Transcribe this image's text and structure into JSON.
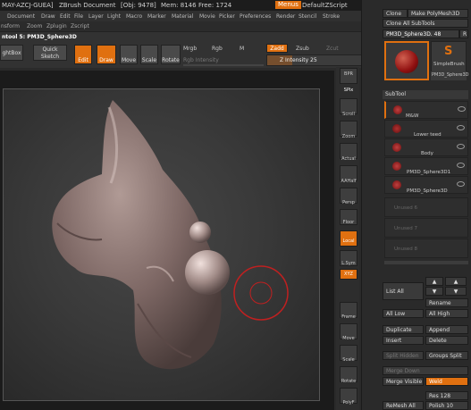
{
  "titlebar": {
    "doc_left": "MAY-AZCJ-GUEA]",
    "app": "ZBrush Document",
    "obj": "[Obj: 9478]",
    "mem": "Mem: 8146",
    "free": "Free: 1724",
    "menus": "Menus",
    "script": "DefaultZScript"
  },
  "menubar": [
    "Document",
    "Draw",
    "Edit",
    "File",
    "Layer",
    "Light",
    "Macro",
    "Marker",
    "Material",
    "Movie",
    "Picker",
    "Preferences",
    "Render",
    "Stencil",
    "Stroke"
  ],
  "subbar": [
    "nsform",
    "Zoom",
    "Zplugin",
    "Zscript"
  ],
  "tool_title": "ntool 5: PM3D_Sphere3D",
  "toolbar": {
    "lightbox": "ghtBox",
    "quick_sketch": "Quick Sketch",
    "edit": "Edit",
    "draw": "Draw",
    "move": "Move",
    "scale": "Scale",
    "rotate": "Rotate",
    "mrgb": "Mrgb",
    "rgb": "Rgb",
    "m": "M",
    "zadd": "Zadd",
    "zsub": "Zsub",
    "zcut": "Zcut",
    "rgb_intensity": "Rgb Intensity",
    "z_intensity": "Z Intensity 25"
  },
  "shelf": [
    "BPR",
    "SPix",
    "Scroll",
    "Zoom",
    "Actual",
    "AAHalf",
    "Persp",
    "Floor",
    "Local",
    "L.Sym",
    "XYZ",
    "Frame",
    "Move",
    "Scale",
    "Rotate",
    "PolyF"
  ],
  "panel": {
    "clone": "Clone",
    "make_polymesh": "Make PolyMesh3D",
    "clone_all": "Clone All SubTools",
    "tool_name": "PM3D_Sphere3D. 48",
    "r": "R",
    "simplebrush": "SimpleBrush",
    "pm3d": "PM3D_Sphere3D",
    "subtool": "SubTool",
    "items": [
      {
        "label": "M&W"
      },
      {
        "label": "Lower teed"
      },
      {
        "label": "Body"
      },
      {
        "label": "PM3D_Sphere3D1"
      },
      {
        "label": "PM3D_Sphere3D"
      }
    ],
    "unused": [
      "Unused 6",
      "Unused 7",
      "Unused 8"
    ],
    "list_all": "List All",
    "rename": "Rename",
    "all_low": "All Low",
    "all_high": "All High",
    "duplicate": "Duplicate",
    "append": "Append",
    "insert": "Insert",
    "delete": "Delete",
    "split_hidden": "Split Hidden",
    "groups_split": "Groups Split",
    "merge_down": "Merge Down",
    "merge_visible": "Merge Visible",
    "weld": "Weld",
    "res": "Res 128",
    "remesh_all": "ReMesh All",
    "polish": "Polish 10"
  },
  "colors": {
    "accent": "#e07010",
    "panel": "#2a2a2a",
    "sculpt": "#8a7470"
  }
}
